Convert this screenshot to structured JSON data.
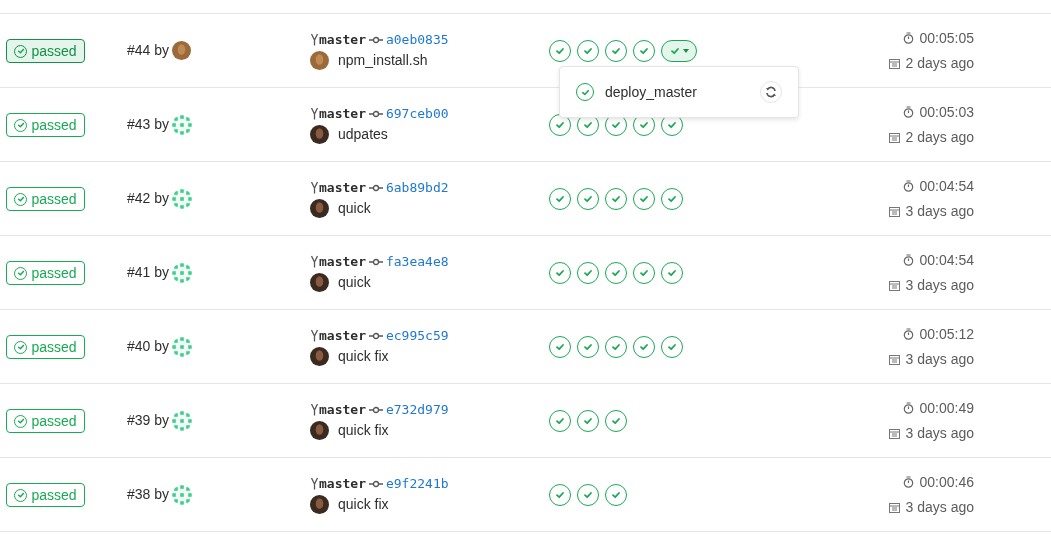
{
  "pipelines": [
    {
      "status": "passed",
      "highlighted": true,
      "label": "#44 by",
      "author_avatar": {
        "kind": "photo"
      },
      "branch": "master",
      "commit": "a0eb0835",
      "commit_avatar": {
        "kind": "photo"
      },
      "message": "npm_install.sh",
      "stages": [
        {
          "kind": "single"
        },
        {
          "kind": "single"
        },
        {
          "kind": "single"
        },
        {
          "kind": "single"
        },
        {
          "kind": "dropdown",
          "expanded": true,
          "jobs": [
            {
              "name": "deploy_master"
            }
          ]
        }
      ],
      "duration": "00:05:05",
      "finished": "2 days ago"
    },
    {
      "status": "passed",
      "highlighted": false,
      "label": "#43 by",
      "author_avatar": {
        "kind": "identicon"
      },
      "branch": "master",
      "commit": "697ceb00",
      "commit_avatar": {
        "kind": "dark"
      },
      "message": "udpates",
      "stages": [
        {
          "kind": "single"
        },
        {
          "kind": "single"
        },
        {
          "kind": "single"
        },
        {
          "kind": "single"
        },
        {
          "kind": "single"
        }
      ],
      "duration": "00:05:03",
      "finished": "2 days ago"
    },
    {
      "status": "passed",
      "highlighted": false,
      "label": "#42 by",
      "author_avatar": {
        "kind": "identicon"
      },
      "branch": "master",
      "commit": "6ab89bd2",
      "commit_avatar": {
        "kind": "dark"
      },
      "message": "quick",
      "stages": [
        {
          "kind": "single"
        },
        {
          "kind": "single"
        },
        {
          "kind": "single"
        },
        {
          "kind": "single"
        },
        {
          "kind": "single"
        }
      ],
      "duration": "00:04:54",
      "finished": "3 days ago"
    },
    {
      "status": "passed",
      "highlighted": false,
      "label": "#41 by",
      "author_avatar": {
        "kind": "identicon"
      },
      "branch": "master",
      "commit": "fa3ea4e8",
      "commit_avatar": {
        "kind": "dark"
      },
      "message": "quick",
      "stages": [
        {
          "kind": "single"
        },
        {
          "kind": "single"
        },
        {
          "kind": "single"
        },
        {
          "kind": "single"
        },
        {
          "kind": "single"
        }
      ],
      "duration": "00:04:54",
      "finished": "3 days ago"
    },
    {
      "status": "passed",
      "highlighted": false,
      "label": "#40 by",
      "author_avatar": {
        "kind": "identicon"
      },
      "branch": "master",
      "commit": "ec995c59",
      "commit_avatar": {
        "kind": "dark"
      },
      "message": "quick fix",
      "stages": [
        {
          "kind": "single"
        },
        {
          "kind": "single"
        },
        {
          "kind": "single"
        },
        {
          "kind": "single"
        },
        {
          "kind": "single"
        }
      ],
      "duration": "00:05:12",
      "finished": "3 days ago"
    },
    {
      "status": "passed",
      "highlighted": false,
      "label": "#39 by",
      "author_avatar": {
        "kind": "identicon"
      },
      "branch": "master",
      "commit": "e732d979",
      "commit_avatar": {
        "kind": "dark"
      },
      "message": "quick fix",
      "stages": [
        {
          "kind": "single"
        },
        {
          "kind": "single"
        },
        {
          "kind": "single"
        }
      ],
      "duration": "00:00:49",
      "finished": "3 days ago"
    },
    {
      "status": "passed",
      "highlighted": false,
      "label": "#38 by",
      "author_avatar": {
        "kind": "identicon"
      },
      "branch": "master",
      "commit": "e9f2241b",
      "commit_avatar": {
        "kind": "dark"
      },
      "message": "quick fix",
      "stages": [
        {
          "kind": "single"
        },
        {
          "kind": "single"
        },
        {
          "kind": "single"
        }
      ],
      "duration": "00:00:46",
      "finished": "3 days ago"
    }
  ]
}
